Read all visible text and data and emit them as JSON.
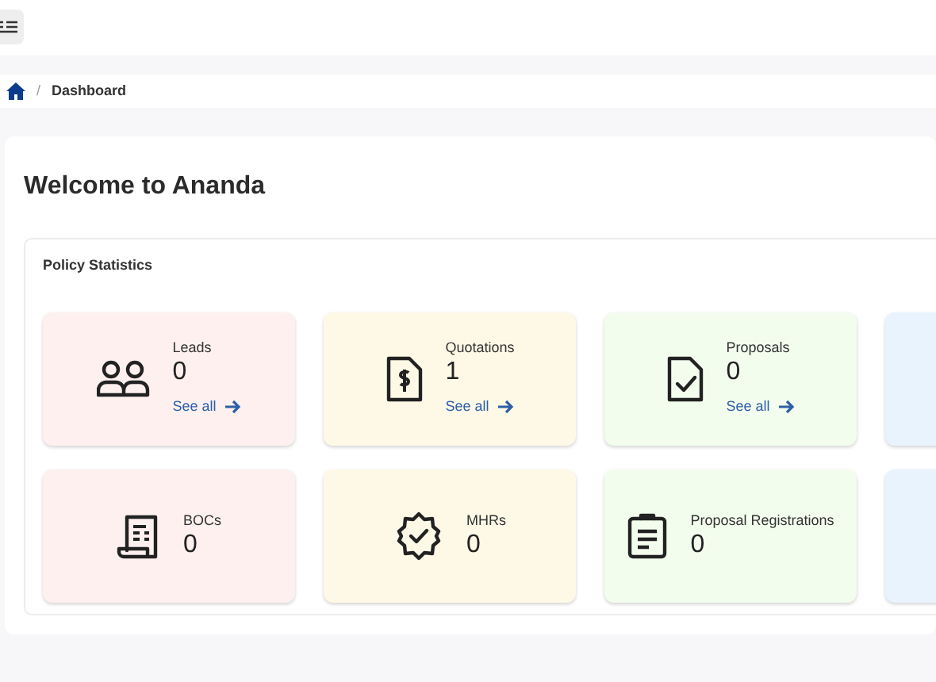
{
  "breadcrumb": [
    {
      "separator": "/",
      "label": "Dashboard"
    }
  ],
  "welcome": {
    "title": "Welcome to Ananda"
  },
  "policy_statistics": {
    "title": "Policy Statistics",
    "rows": [
      [
        {
          "label": "Leads",
          "count": "0",
          "link": "See all",
          "color": "#fdf0ef"
        },
        {
          "label": "Quotations",
          "count": "1",
          "link": "See all",
          "color": "#fef9e7"
        },
        {
          "label": "Proposals",
          "count": "0",
          "link": "See all",
          "color": "#f3fdee"
        },
        {
          "color": "#e8f3fe"
        }
      ],
      [
        {
          "label": "BOCs",
          "count": "0",
          "color": "#fdf0ef"
        },
        {
          "label": "MHRs",
          "count": "0",
          "color": "#fef9e7"
        },
        {
          "label": "Proposal Registrations",
          "count": "0",
          "color": "#f3fdee"
        },
        {
          "color": "#e8f3fe"
        }
      ]
    ]
  }
}
